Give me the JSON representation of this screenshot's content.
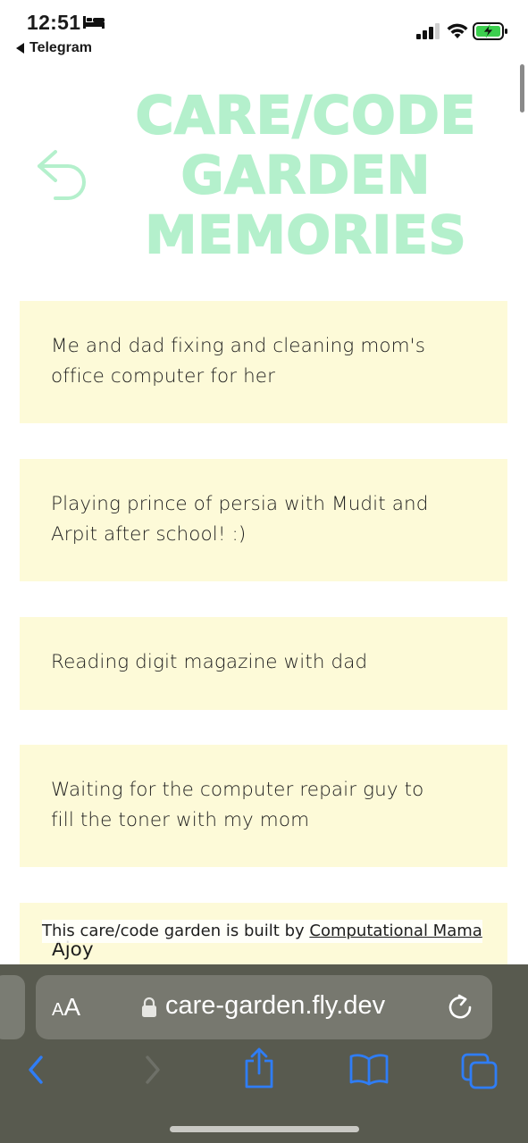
{
  "status_bar": {
    "time": "12:51",
    "back_app": "Telegram",
    "icons": [
      "bed-icon",
      "signal-icon",
      "wifi-icon",
      "battery-charging-icon"
    ]
  },
  "header": {
    "title_lines": [
      "CARE/CODE",
      "GARDEN",
      "MEMORIES"
    ],
    "back_icon": "undo-arrow-icon",
    "title_color": "#b4f0cc"
  },
  "memories": [
    "Me and dad fixing and cleaning mom's office computer for her",
    "Playing prince of persia with Mudit and Arpit after school! :)",
    "Reading digit magazine with dad",
    "Waiting for the computer repair guy to fill the toner with my mom",
    "Ajoy"
  ],
  "footer": {
    "prefix": "This care/code garden is built by ",
    "link": "Computational Mama"
  },
  "browser": {
    "aa_small": "A",
    "aa_big": "A",
    "url": "care-garden.fly.dev",
    "icons": [
      "lock-icon",
      "reload-icon",
      "back-icon",
      "forward-icon",
      "share-icon",
      "bookmarks-icon",
      "tabs-icon"
    ]
  },
  "colors": {
    "card_bg": "#fdfad8",
    "accent_green": "#b4f0cc",
    "toolbar_bg": "#585a4f",
    "ios_blue": "#2f7df6"
  }
}
